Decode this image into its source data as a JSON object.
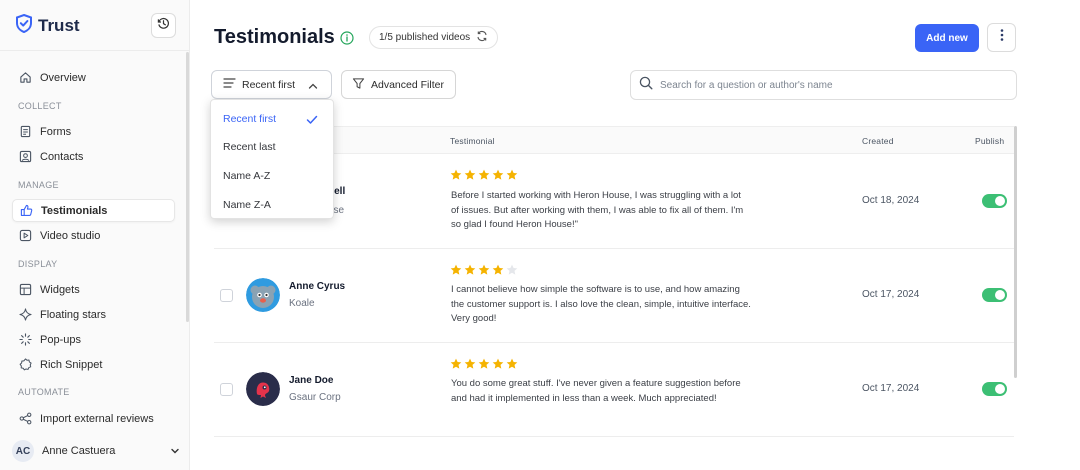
{
  "app": {
    "brand": "Trust",
    "brand_color": "#3a64f6"
  },
  "sidebar": {
    "overview": "Overview",
    "sections": {
      "collect": "COLLECT",
      "manage": "MANAGE",
      "display": "DISPLAY",
      "automate": "AUTOMATE"
    },
    "items": {
      "forms": "Forms",
      "contacts": "Contacts",
      "testimonials": "Testimonials",
      "video_studio": "Video studio",
      "widgets": "Widgets",
      "floating_stars": "Floating stars",
      "popups": "Pop-ups",
      "rich_snippet": "Rich Snippet",
      "import_reviews": "Import external reviews"
    },
    "active_item": "testimonials",
    "user": {
      "initials": "AC",
      "name": "Anne Castuera"
    }
  },
  "header": {
    "title": "Testimonials",
    "published_badge": "1/5 published videos",
    "add_button": "Add new"
  },
  "toolbar": {
    "sort_label": "Recent first",
    "filter_label": "Advanced Filter",
    "search_placeholder": "Search for a question or author's name"
  },
  "sort_menu": {
    "options": [
      "Recent first",
      "Recent last",
      "Name A-Z",
      "Name Z-A"
    ],
    "selected": "Recent first"
  },
  "table": {
    "columns": {
      "testimonial": "Testimonial",
      "created": "Created",
      "publish": "Publish"
    },
    "rows": [
      {
        "name_partial": "nell",
        "company_partial": "use",
        "rating": 5,
        "text": "Before I started working with Heron House, I was struggling with a lot of issues. But after working with them, I was able to fix all of them. I'm so glad I found Heron House!\"",
        "created": "Oct 18, 2024",
        "published": true
      },
      {
        "name": "Anne Cyrus",
        "company": "Koale",
        "rating": 4,
        "text": "I cannot believe how simple the software is to use, and how amazing the customer support is. I also love the clean, simple, intuitive interface. Very good!",
        "created": "Oct 17, 2024",
        "published": true
      },
      {
        "name": "Jane Doe",
        "company": "Gsaur Corp",
        "rating": 5,
        "text": "You do some great stuff. I've never given a feature suggestion before and had it implemented in less than a week. Much appreciated!",
        "created": "Oct 17, 2024",
        "published": true
      }
    ]
  },
  "colors": {
    "accent": "#3a64f6",
    "star": "#f5b301",
    "star_empty": "#e5e7eb",
    "toggle_on": "#3cbf74",
    "info_green": "#22a55a"
  }
}
